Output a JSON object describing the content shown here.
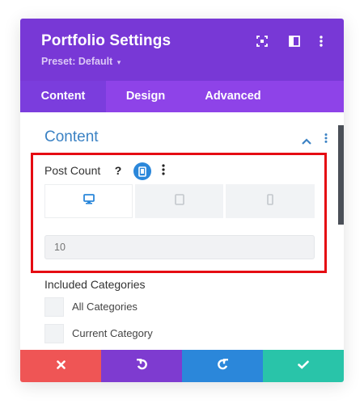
{
  "header": {
    "title": "Portfolio Settings",
    "preset_label": "Preset: Default",
    "preset_caret": "▾",
    "icons": [
      "expand-icon",
      "sidebar-layout-icon",
      "more-vertical-icon"
    ]
  },
  "tabs": [
    {
      "label": "Content",
      "active": true
    },
    {
      "label": "Design",
      "active": false
    },
    {
      "label": "Advanced",
      "active": false
    }
  ],
  "section": {
    "title": "Content"
  },
  "post_count": {
    "label": "Post Count",
    "help": "?",
    "device_tabs": [
      "desktop-icon",
      "tablet-icon",
      "phone-icon"
    ],
    "active_device": "desktop",
    "placeholder": "10"
  },
  "categories": {
    "label": "Included Categories",
    "items": [
      {
        "label": "All Categories",
        "checked": false
      },
      {
        "label": "Current Category",
        "checked": false
      }
    ]
  },
  "footer": {
    "buttons": [
      {
        "name": "cancel",
        "icon": "close-icon",
        "color": "#ef5555"
      },
      {
        "name": "undo",
        "icon": "undo-icon",
        "color": "#7e3bd0"
      },
      {
        "name": "redo",
        "icon": "redo-icon",
        "color": "#2b87da"
      },
      {
        "name": "save",
        "icon": "check-icon",
        "color": "#29c4a9"
      }
    ]
  },
  "colors": {
    "header": "#7838d6",
    "tabs": "#8e43e8",
    "accent_blue": "#2b87da",
    "highlight": "#e50b12"
  }
}
